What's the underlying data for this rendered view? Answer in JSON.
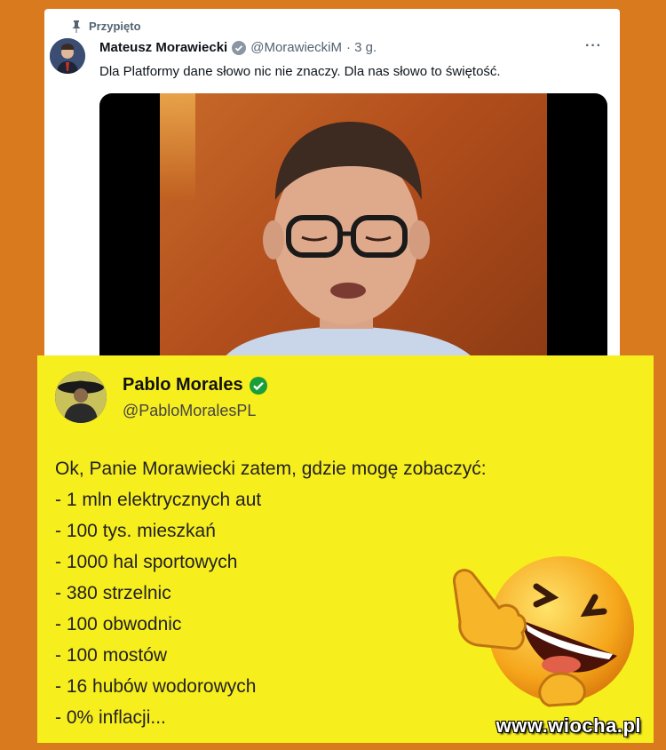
{
  "top_tweet": {
    "pinned_label": "Przypięto",
    "author_name": "Mateusz Morawiecki",
    "author_handle": "@MorawieckiM",
    "time": "· 3 g.",
    "more": "···",
    "text": "Dla Platformy dane słowo nic nie znaczy. Dla nas słowo to świętość."
  },
  "bottom_tweet": {
    "author_name": "Pablo Morales",
    "author_handle": "@PabloMoralesPL",
    "lines": [
      "Ok, Panie Morawiecki zatem, gdzie mogę zobaczyć:",
      "- 1 mln elektrycznych aut",
      "- 100 tys. mieszkań",
      "- 1000 hal sportowych",
      "- 380 strzelnic",
      "- 100 obwodnic",
      "- 100 mostów",
      "- 16 hubów wodorowych",
      "- 0% inflacji..."
    ]
  },
  "watermark": "www.wiocha.pl",
  "colors": {
    "background": "#d97a1e",
    "yellow_card": "#f7ee1e",
    "verified_blue": "#1d9bf0",
    "verified_green": "#1a9e3a"
  },
  "icons": {
    "pin": "pin-icon",
    "verified_top": "verified-badge-icon",
    "verified_bottom": "verified-badge-icon",
    "emoji": "laughing-emoji-icon"
  }
}
